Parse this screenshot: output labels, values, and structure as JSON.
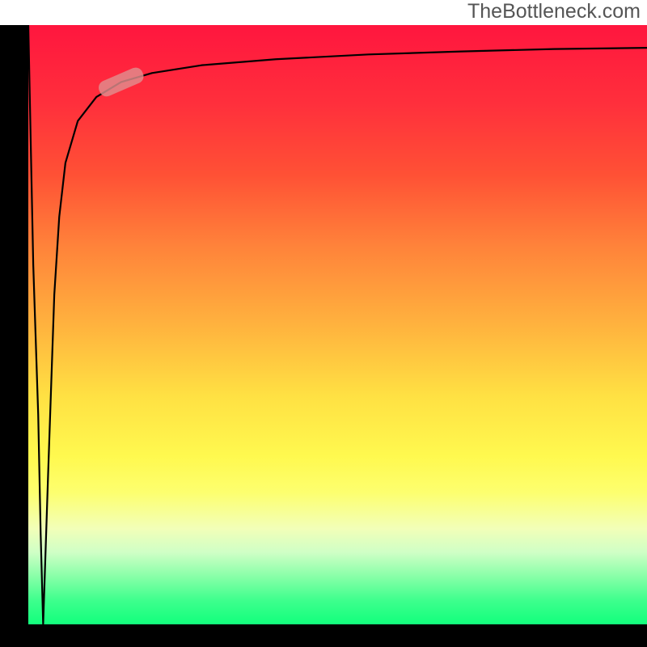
{
  "attribution": "TheBottleneck.com",
  "chart_data": {
    "type": "line",
    "title": "",
    "xlabel": "",
    "ylabel": "",
    "xlim": [
      0,
      100
    ],
    "ylim": [
      0,
      100
    ],
    "grid": false,
    "legend": false,
    "series": [
      {
        "name": "bottleneck-curve",
        "x": [
          0.0,
          0.8,
          1.6,
          2.0,
          2.4,
          3.2,
          4.2,
          5.0,
          6.0,
          8.0,
          11.0,
          15.0,
          20.0,
          28.0,
          40.0,
          55.0,
          70.0,
          85.0,
          100.0
        ],
        "values": [
          100,
          60.0,
          35.0,
          15.0,
          0.0,
          25.0,
          55.0,
          68.0,
          77.0,
          84.0,
          88.0,
          90.5,
          92.0,
          93.3,
          94.3,
          95.1,
          95.6,
          96.0,
          96.2
        ]
      }
    ],
    "highlight_marker": {
      "series": "bottleneck-curve",
      "x": 15.0,
      "y": 90.5,
      "color": "#e08e8e",
      "shape": "pill"
    },
    "gradient_stops": [
      {
        "pct": 0,
        "color": "#ff163e"
      },
      {
        "pct": 13,
        "color": "#ff2f3c"
      },
      {
        "pct": 25,
        "color": "#ff5135"
      },
      {
        "pct": 37,
        "color": "#ff833a"
      },
      {
        "pct": 50,
        "color": "#ffb23e"
      },
      {
        "pct": 62,
        "color": "#ffe143"
      },
      {
        "pct": 72,
        "color": "#fff94f"
      },
      {
        "pct": 78,
        "color": "#fdff6f"
      },
      {
        "pct": 84,
        "color": "#f2ffb8"
      },
      {
        "pct": 88,
        "color": "#cfffc6"
      },
      {
        "pct": 92,
        "color": "#88ffa8"
      },
      {
        "pct": 96,
        "color": "#3eff8d"
      },
      {
        "pct": 100,
        "color": "#12ff7c"
      }
    ]
  }
}
